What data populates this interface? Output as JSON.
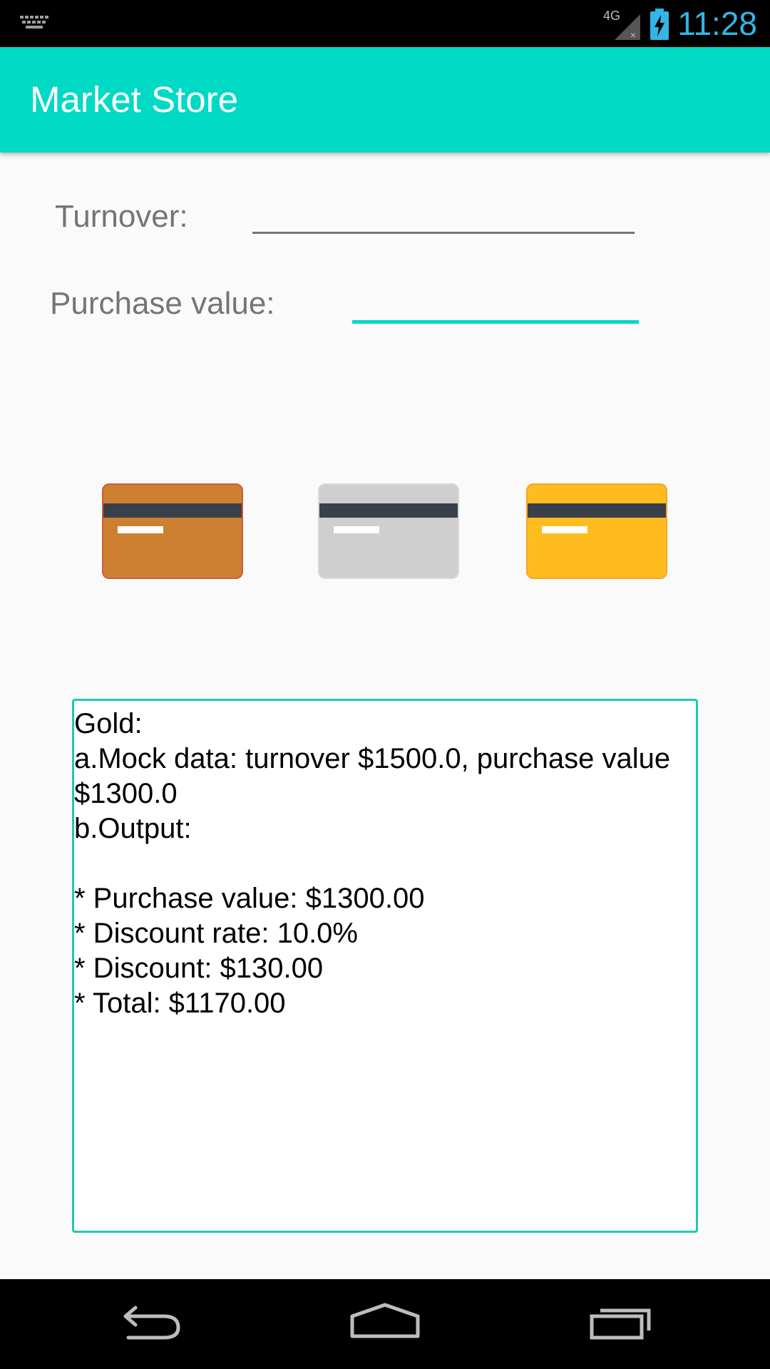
{
  "status_bar": {
    "time": "11:28",
    "network_label": "4G",
    "icons": [
      "keyboard-icon",
      "signal-icon",
      "battery-charging-icon"
    ],
    "clock_color": "#33b5e5"
  },
  "app_bar": {
    "title": "Market Store",
    "color": "#00d9c4"
  },
  "form": {
    "turnover_label": "Turnover:",
    "turnover_value": "",
    "purchase_label": "Purchase value:",
    "purchase_value": ""
  },
  "cards": [
    {
      "name": "bronze",
      "color": "#cd7f32"
    },
    {
      "name": "silver",
      "color": "#cfcfcf"
    },
    {
      "name": "gold",
      "color": "#ffbc1f"
    }
  ],
  "output": {
    "text": "Gold:\na.Mock data: turnover $1500.0, purchase value $1300.0\nb.Output:\n\n* Purchase value: $1300.00\n* Discount rate: 10.0%\n* Discount: $130.00\n* Total: $1170.00"
  },
  "nav_bar": {
    "icons": [
      "back-icon",
      "home-icon",
      "recent-apps-icon"
    ]
  }
}
